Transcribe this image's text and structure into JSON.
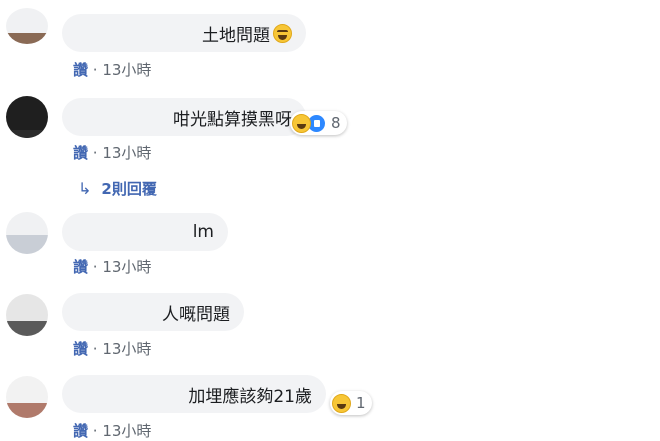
{
  "comments": [
    {
      "text": "土地問題",
      "emoji": "rofl-emoji",
      "like_label": "讚",
      "separator": " · ",
      "time": "13小時"
    },
    {
      "text": "咁光點算摸黑呀",
      "reactions": [
        "haha-reaction-icon",
        "like-reaction-icon"
      ],
      "reaction_count": "8",
      "like_label": "讚",
      "separator": " · ",
      "time": "13小時",
      "replies_label": "2則回覆"
    },
    {
      "text": "lm",
      "like_label": "讚",
      "separator": " · ",
      "time": "13小時"
    },
    {
      "text": "人嘅問題",
      "like_label": "讚",
      "separator": " · ",
      "time": "13小時"
    },
    {
      "text": "加埋應該夠21歲",
      "reactions": [
        "haha-reaction-icon"
      ],
      "reaction_count": "1",
      "like_label": "讚",
      "separator": " · ",
      "time": "13小時"
    }
  ]
}
